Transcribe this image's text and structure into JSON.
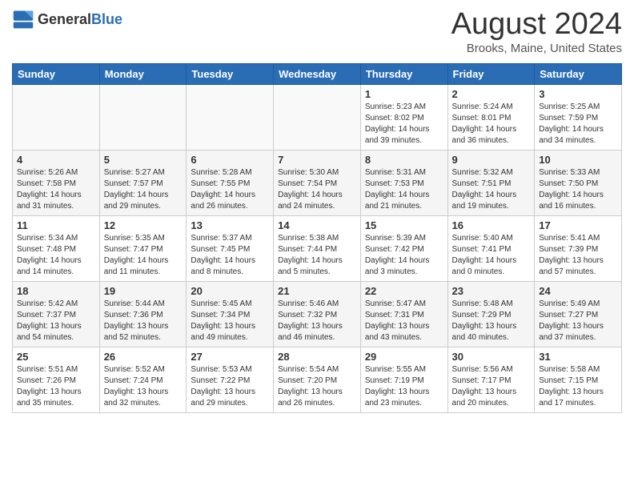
{
  "header": {
    "logo": {
      "general": "General",
      "blue": "Blue"
    },
    "title": "August 2024",
    "location": "Brooks, Maine, United States"
  },
  "weekdays": [
    "Sunday",
    "Monday",
    "Tuesday",
    "Wednesday",
    "Thursday",
    "Friday",
    "Saturday"
  ],
  "weeks": [
    [
      {
        "day": "",
        "info": ""
      },
      {
        "day": "",
        "info": ""
      },
      {
        "day": "",
        "info": ""
      },
      {
        "day": "",
        "info": ""
      },
      {
        "day": "1",
        "info": "Sunrise: 5:23 AM\nSunset: 8:02 PM\nDaylight: 14 hours\nand 39 minutes."
      },
      {
        "day": "2",
        "info": "Sunrise: 5:24 AM\nSunset: 8:01 PM\nDaylight: 14 hours\nand 36 minutes."
      },
      {
        "day": "3",
        "info": "Sunrise: 5:25 AM\nSunset: 7:59 PM\nDaylight: 14 hours\nand 34 minutes."
      }
    ],
    [
      {
        "day": "4",
        "info": "Sunrise: 5:26 AM\nSunset: 7:58 PM\nDaylight: 14 hours\nand 31 minutes."
      },
      {
        "day": "5",
        "info": "Sunrise: 5:27 AM\nSunset: 7:57 PM\nDaylight: 14 hours\nand 29 minutes."
      },
      {
        "day": "6",
        "info": "Sunrise: 5:28 AM\nSunset: 7:55 PM\nDaylight: 14 hours\nand 26 minutes."
      },
      {
        "day": "7",
        "info": "Sunrise: 5:30 AM\nSunset: 7:54 PM\nDaylight: 14 hours\nand 24 minutes."
      },
      {
        "day": "8",
        "info": "Sunrise: 5:31 AM\nSunset: 7:53 PM\nDaylight: 14 hours\nand 21 minutes."
      },
      {
        "day": "9",
        "info": "Sunrise: 5:32 AM\nSunset: 7:51 PM\nDaylight: 14 hours\nand 19 minutes."
      },
      {
        "day": "10",
        "info": "Sunrise: 5:33 AM\nSunset: 7:50 PM\nDaylight: 14 hours\nand 16 minutes."
      }
    ],
    [
      {
        "day": "11",
        "info": "Sunrise: 5:34 AM\nSunset: 7:48 PM\nDaylight: 14 hours\nand 14 minutes."
      },
      {
        "day": "12",
        "info": "Sunrise: 5:35 AM\nSunset: 7:47 PM\nDaylight: 14 hours\nand 11 minutes."
      },
      {
        "day": "13",
        "info": "Sunrise: 5:37 AM\nSunset: 7:45 PM\nDaylight: 14 hours\nand 8 minutes."
      },
      {
        "day": "14",
        "info": "Sunrise: 5:38 AM\nSunset: 7:44 PM\nDaylight: 14 hours\nand 5 minutes."
      },
      {
        "day": "15",
        "info": "Sunrise: 5:39 AM\nSunset: 7:42 PM\nDaylight: 14 hours\nand 3 minutes."
      },
      {
        "day": "16",
        "info": "Sunrise: 5:40 AM\nSunset: 7:41 PM\nDaylight: 14 hours\nand 0 minutes."
      },
      {
        "day": "17",
        "info": "Sunrise: 5:41 AM\nSunset: 7:39 PM\nDaylight: 13 hours\nand 57 minutes."
      }
    ],
    [
      {
        "day": "18",
        "info": "Sunrise: 5:42 AM\nSunset: 7:37 PM\nDaylight: 13 hours\nand 54 minutes."
      },
      {
        "day": "19",
        "info": "Sunrise: 5:44 AM\nSunset: 7:36 PM\nDaylight: 13 hours\nand 52 minutes."
      },
      {
        "day": "20",
        "info": "Sunrise: 5:45 AM\nSunset: 7:34 PM\nDaylight: 13 hours\nand 49 minutes."
      },
      {
        "day": "21",
        "info": "Sunrise: 5:46 AM\nSunset: 7:32 PM\nDaylight: 13 hours\nand 46 minutes."
      },
      {
        "day": "22",
        "info": "Sunrise: 5:47 AM\nSunset: 7:31 PM\nDaylight: 13 hours\nand 43 minutes."
      },
      {
        "day": "23",
        "info": "Sunrise: 5:48 AM\nSunset: 7:29 PM\nDaylight: 13 hours\nand 40 minutes."
      },
      {
        "day": "24",
        "info": "Sunrise: 5:49 AM\nSunset: 7:27 PM\nDaylight: 13 hours\nand 37 minutes."
      }
    ],
    [
      {
        "day": "25",
        "info": "Sunrise: 5:51 AM\nSunset: 7:26 PM\nDaylight: 13 hours\nand 35 minutes."
      },
      {
        "day": "26",
        "info": "Sunrise: 5:52 AM\nSunset: 7:24 PM\nDaylight: 13 hours\nand 32 minutes."
      },
      {
        "day": "27",
        "info": "Sunrise: 5:53 AM\nSunset: 7:22 PM\nDaylight: 13 hours\nand 29 minutes."
      },
      {
        "day": "28",
        "info": "Sunrise: 5:54 AM\nSunset: 7:20 PM\nDaylight: 13 hours\nand 26 minutes."
      },
      {
        "day": "29",
        "info": "Sunrise: 5:55 AM\nSunset: 7:19 PM\nDaylight: 13 hours\nand 23 minutes."
      },
      {
        "day": "30",
        "info": "Sunrise: 5:56 AM\nSunset: 7:17 PM\nDaylight: 13 hours\nand 20 minutes."
      },
      {
        "day": "31",
        "info": "Sunrise: 5:58 AM\nSunset: 7:15 PM\nDaylight: 13 hours\nand 17 minutes."
      }
    ]
  ]
}
